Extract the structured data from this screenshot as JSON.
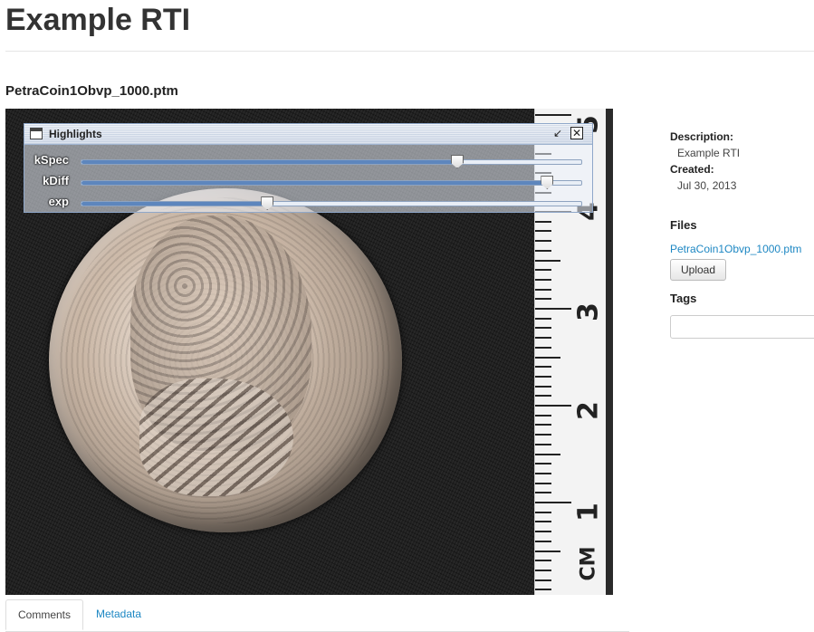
{
  "page": {
    "title": "Example RTI"
  },
  "file": {
    "name": "PetraCoin1Obvp_1000.ptm"
  },
  "viewer": {
    "ruler_numbers": [
      "5",
      "4",
      "3",
      "2",
      "1",
      "CM"
    ],
    "panel": {
      "title": "Highlights",
      "sliders": [
        {
          "label": "kSpec",
          "value": 0.75
        },
        {
          "label": "kDiff",
          "value": 0.93
        },
        {
          "label": "exp",
          "value": 0.37
        }
      ]
    }
  },
  "sidebar": {
    "description_label": "Description:",
    "description_value": "Example RTI",
    "created_label": "Created:",
    "created_value": "Jul 30, 2013",
    "files_heading": "Files",
    "file_link": "PetraCoin1Obvp_1000.ptm",
    "upload_label": "Upload",
    "tags_heading": "Tags",
    "tags_value": ""
  },
  "tabs": [
    {
      "label": "Comments",
      "active": true
    },
    {
      "label": "Metadata",
      "active": false
    }
  ],
  "colors": {
    "link": "#1d87c3",
    "slider_fill": "#5d86bd"
  }
}
